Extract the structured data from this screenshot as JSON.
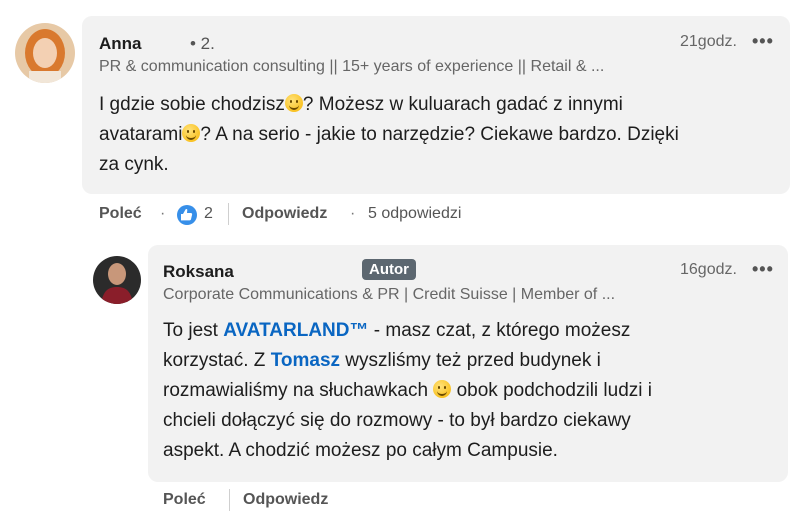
{
  "comment": {
    "author": "Anna",
    "degree": "• 2.",
    "headline": "PR & communication consulting || 15+ years of experience || Retail & ...",
    "time": "21godz.",
    "more": "•••",
    "text_1": "I gdzie sobie chodzisz",
    "text_2": "? Możesz w kuluarach gadać z innymi",
    "text_3": "avatarami",
    "text_4": "? A na serio - jakie to narzędzie? Ciekawe bardzo. Dzięki",
    "text_5": "za cynk.",
    "actions": {
      "recommend": "Poleć",
      "dot": "·",
      "like_count": "2",
      "reply": "Odpowiedz",
      "dot2": "·",
      "replies": "5 odpowiedzi"
    }
  },
  "reply": {
    "author": "Roksana",
    "badge": "Autor",
    "headline": "Corporate Communications & PR | Credit Suisse | Member of ...",
    "time": "16godz.",
    "more": "•••",
    "t1": "To jest ",
    "mention1": "AVATARLAND™",
    "t2": " - masz czat, z którego możesz",
    "t3": "korzystać. Z ",
    "mention2": "Tomasz",
    "t4": " wyszliśmy też przed budynek i",
    "t5": "rozmawialiśmy na słuchawkach ",
    "t6": " obok podchodzili ludzi i",
    "t7": "chcieli dołączyć się do rozmowy - to był bardzo ciekawy",
    "t8": "aspekt. A chodzić możesz po całym Campusie.",
    "actions": {
      "recommend": "Poleć",
      "reply": "Odpowiedz"
    }
  },
  "icons": {
    "emoji": "grinning-emoji-icon",
    "like": "thumbs-up-icon",
    "avatar_anna": "avatar-photo",
    "avatar_roksana": "avatar-photo"
  },
  "colors": {
    "mention": "#0a66c2",
    "bubble": "#f2f2f2",
    "badge": "#5c6770",
    "like": "#378fe9"
  }
}
